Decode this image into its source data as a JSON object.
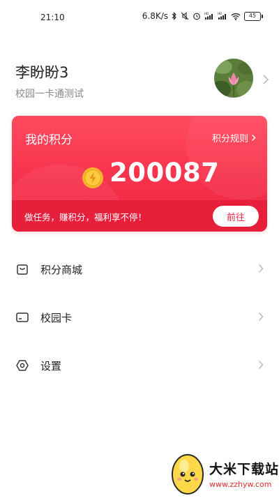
{
  "status_bar": {
    "time": "21:10",
    "net_speed": "6.8K/s",
    "signal_tag_1": "HD",
    "signal_tag_2": "HD",
    "battery": "45"
  },
  "profile": {
    "name": "李盼盼3",
    "subtitle": "校园一卡通测试"
  },
  "points_card": {
    "title": "我的积分",
    "rules_label": "积分规则",
    "value": "200087",
    "slogan": "做任务，赚积分，福利享不停！",
    "go_button": "前往"
  },
  "menu": [
    {
      "label": "积分商城",
      "icon": "shopping-bag-icon"
    },
    {
      "label": "校园卡",
      "icon": "card-icon"
    },
    {
      "label": "设置",
      "icon": "settings-hex-icon"
    }
  ],
  "watermark": {
    "title": "大米下载站",
    "url": "www.zzhyw.com"
  },
  "colors": {
    "card_red": "#f5304a",
    "footer_red": "#e81f3a",
    "coin_gold": "#f7b52c"
  }
}
